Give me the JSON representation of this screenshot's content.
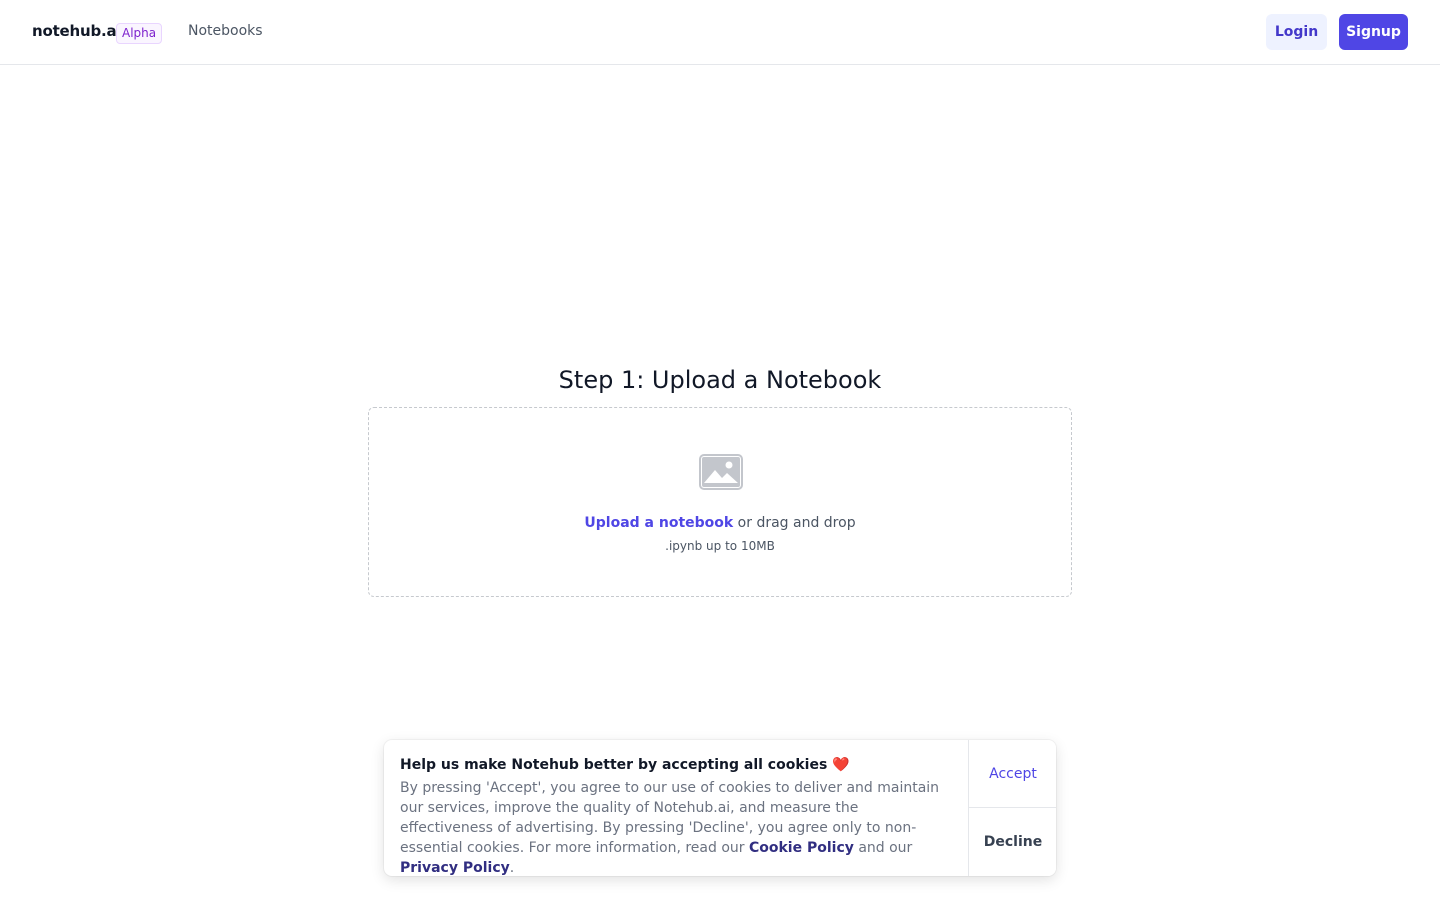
{
  "header": {
    "brand": "notehub.ai",
    "badge": "Alpha",
    "nav": {
      "notebooks": "Notebooks"
    },
    "login": "Login",
    "signup": "Signup"
  },
  "main": {
    "title": "Step 1: Upload a Notebook",
    "dropzone": {
      "icon": "image-icon",
      "link": "Upload a notebook",
      "text": " or drag and drop",
      "hint": ".ipynb up to 10MB"
    }
  },
  "cookie": {
    "title": "Help us make Notehub better by accepting all cookies",
    "heart": "❤️",
    "body_prefix": "By pressing 'Accept', you agree to our use of cookies to deliver and maintain our services, improve the quality of Notehub.ai, and measure the effectiveness of advertising. By pressing 'Decline', you agree only to non-essential cookies. For more information, read our ",
    "cookie_policy": "Cookie Policy",
    "and_our": " and our ",
    "privacy_policy": "Privacy Policy",
    "period": ".",
    "accept": "Accept",
    "decline": "Decline"
  },
  "colors": {
    "accent": "#4f46e5",
    "badge_text": "#7e22ce",
    "heart": "#ef4444"
  }
}
